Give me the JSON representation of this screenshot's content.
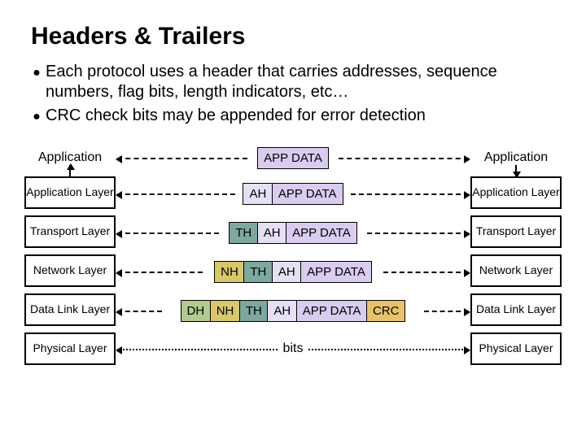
{
  "title": "Headers & Trailers",
  "bullets": [
    "Each protocol uses a header that carries addresses, sequence numbers, flag bits, length indicators, etc…",
    "CRC check bits may be appended for error detection"
  ],
  "app_label": "Application",
  "layers": [
    "Application Layer",
    "Transport Layer",
    "Network Layer",
    "Data Link Layer",
    "Physical Layer"
  ],
  "seg": {
    "app": "APP DATA",
    "ah": "AH",
    "th": "TH",
    "nh": "NH",
    "dh": "DH",
    "crc": "CRC"
  },
  "bits": "bits"
}
